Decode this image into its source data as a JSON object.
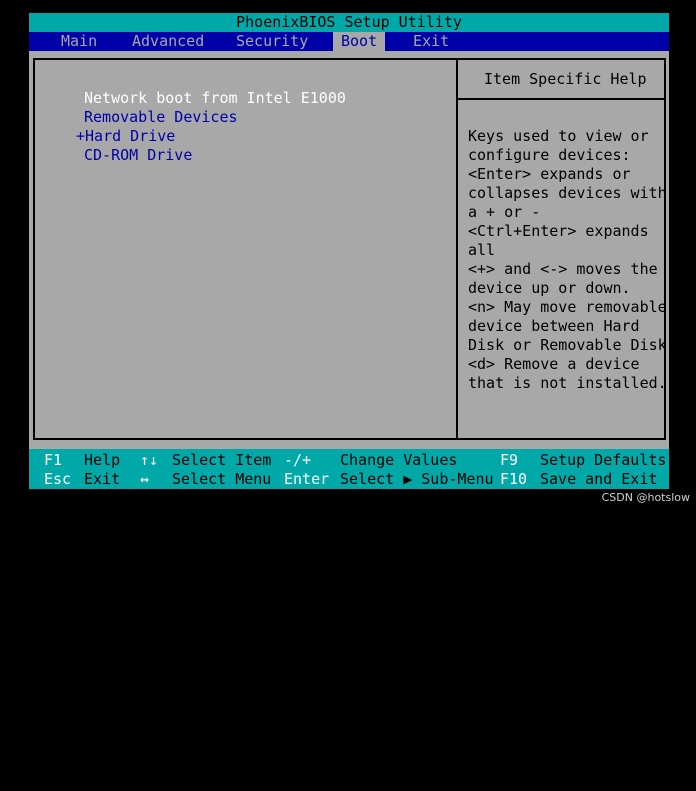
{
  "title": "PhoenixBIOS Setup Utility",
  "menu": {
    "tabs": [
      {
        "label": "Main"
      },
      {
        "label": "Advanced"
      },
      {
        "label": "Security"
      },
      {
        "label": "Boot"
      },
      {
        "label": "Exit"
      }
    ],
    "active_tab": "Boot"
  },
  "boot_order": {
    "items": [
      {
        "label": "Network boot from Intel E1000"
      },
      {
        "label": "Removable Devices"
      },
      {
        "label": "+Hard Drive"
      },
      {
        "label": "CD-ROM Drive"
      }
    ],
    "selected_item": "Network boot from Intel E1000"
  },
  "help": {
    "title": "Item Specific Help",
    "lines": [
      "Keys used to view or",
      "configure devices:",
      "<Enter> expands or",
      "collapses devices with",
      "a + or -",
      "<Ctrl+Enter> expands",
      "all",
      "<+> and <-> moves the",
      "device up or down.",
      "<n> May move removable",
      "device between Hard",
      "Disk or Removable Disk",
      "<d> Remove a device",
      "that is not installed."
    ]
  },
  "status_bar": {
    "row1": [
      {
        "key": "F1",
        "desc": "Help"
      },
      {
        "key": "↑↓",
        "desc": "Select Item"
      },
      {
        "key": "-/+",
        "desc": "Change Values"
      },
      {
        "key": "F9",
        "desc": "Setup Defaults"
      }
    ],
    "row2": [
      {
        "key": "Esc",
        "desc": "Exit"
      },
      {
        "key": "↔",
        "desc": "Select Menu"
      },
      {
        "key": "Enter",
        "desc": "Select ▶ Sub-Menu"
      },
      {
        "key": "F10",
        "desc": "Save and Exit"
      }
    ]
  },
  "watermark": "CSDN @hotslow",
  "colors": {
    "cyan": "#00a8a8",
    "blue": "#0000a8",
    "gray": "#a8a8a8",
    "white": "#ffffff",
    "black": "#000000"
  }
}
